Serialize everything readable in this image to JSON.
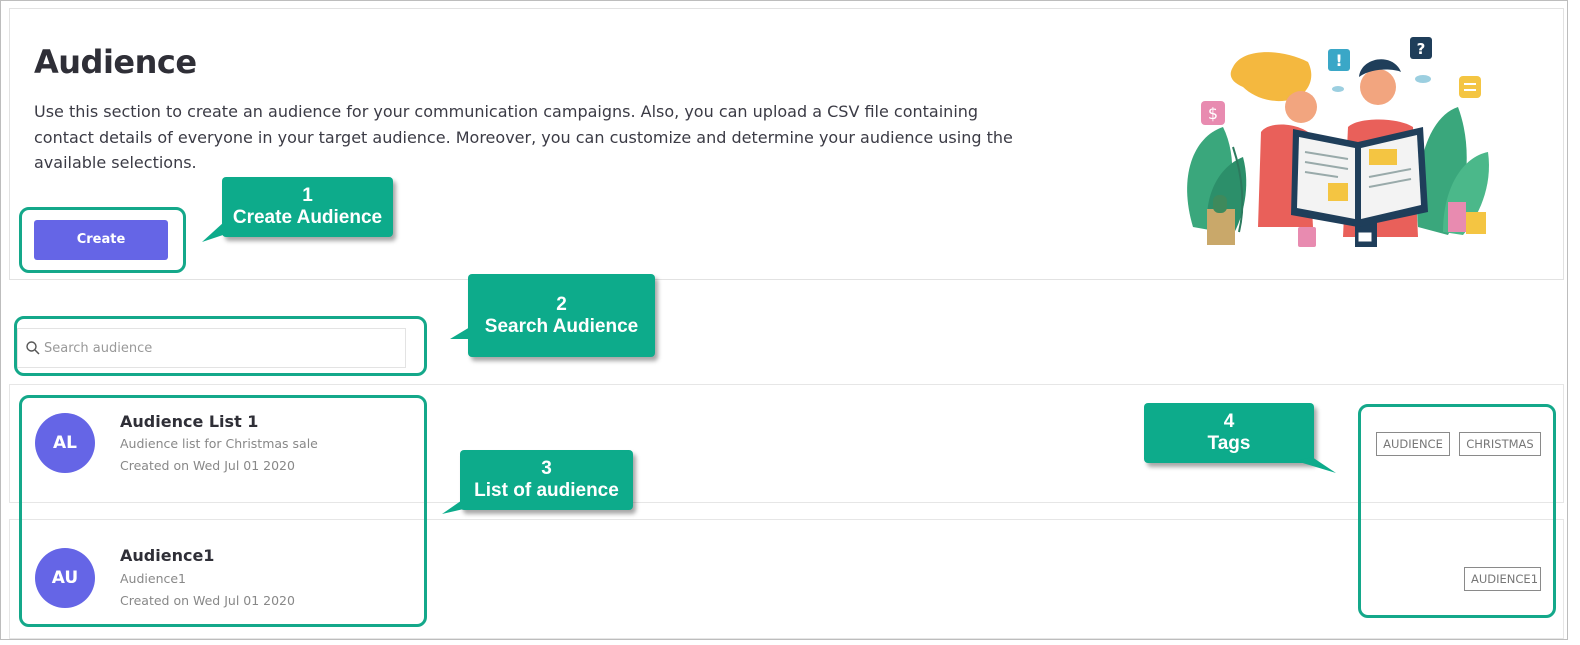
{
  "header": {
    "title": "Audience",
    "description": "Use this section to create an audience for your communication campaigns. Also, you can upload a CSV file containing contact details of everyone in your target audience. Moreover, you can customize and determine your audience using the available selections.",
    "create_label": "Create"
  },
  "search": {
    "placeholder": "Search audience",
    "value": ""
  },
  "audiences": [
    {
      "initials": "AL",
      "name": "Audience List 1",
      "description": "Audience list for Christmas sale",
      "created": "Created on Wed Jul 01 2020",
      "tags": [
        "AUDIENCE",
        "CHRISTMAS"
      ]
    },
    {
      "initials": "AU",
      "name": "Audience1",
      "description": "Audience1",
      "created": "Created on Wed Jul 01 2020",
      "tags": [
        "AUDIENCE1"
      ]
    }
  ],
  "annotations": [
    {
      "number": "1",
      "label": "Create Audience"
    },
    {
      "number": "2",
      "label": "Search Audience"
    },
    {
      "number": "3",
      "label": "List of audience"
    },
    {
      "number": "4",
      "label": "Tags"
    }
  ],
  "colors": {
    "accent": "#6565e6",
    "callout": "#0dab8b",
    "highlight": "#14a88a"
  },
  "icons": {
    "search": "search-icon",
    "illustration": "people-reading-newspaper-illustration"
  }
}
